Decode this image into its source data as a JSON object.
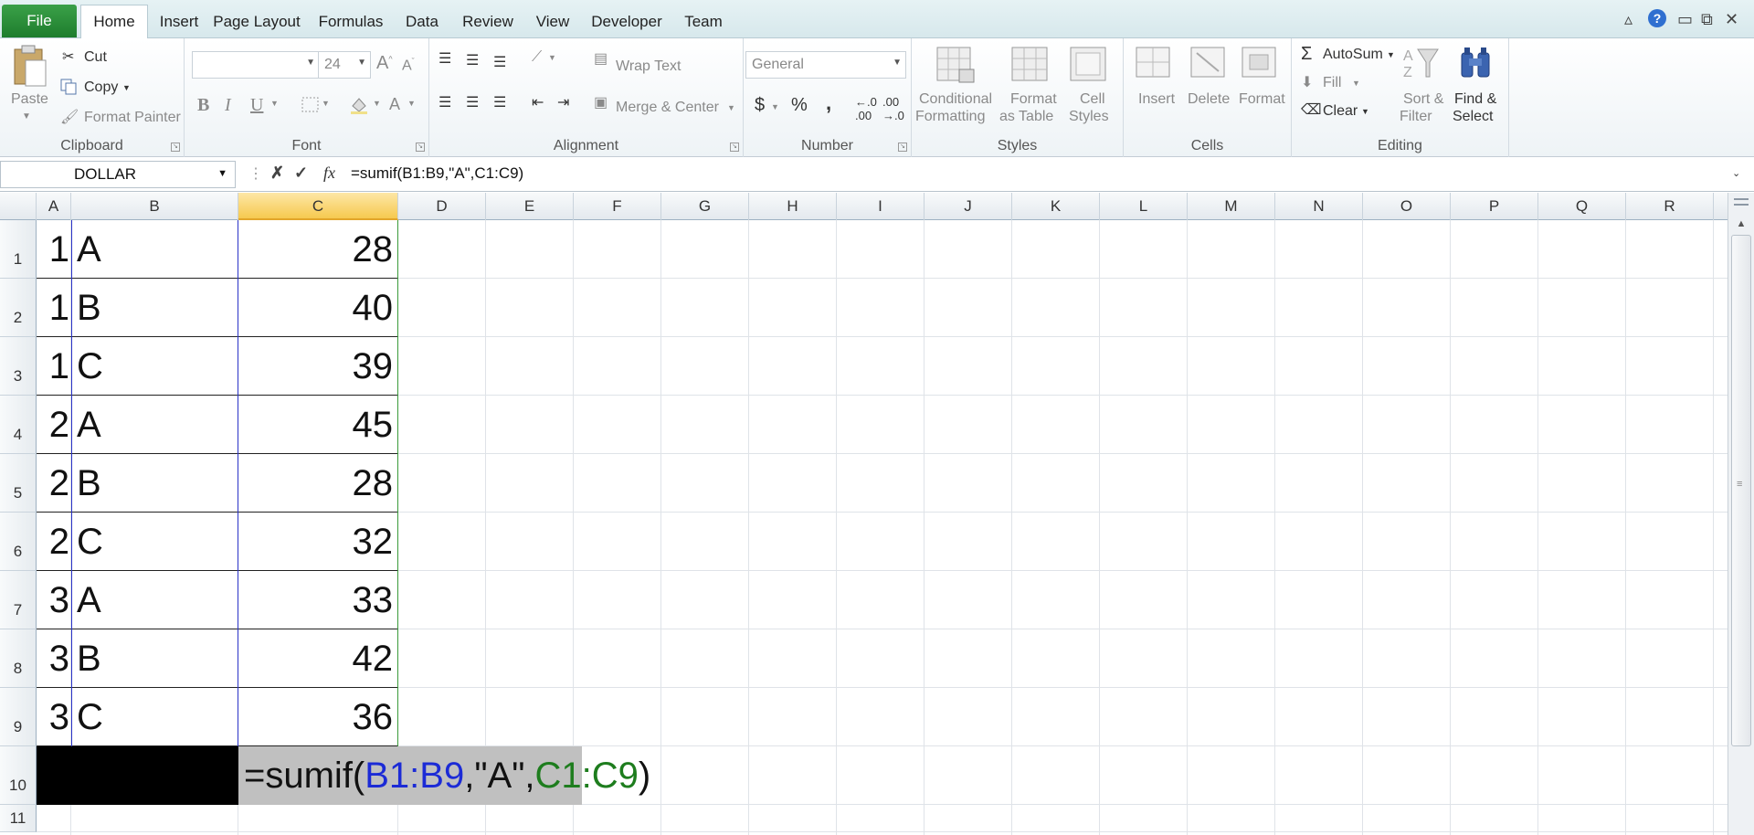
{
  "menu": {
    "file": "File",
    "tabs": [
      "Home",
      "Insert",
      "Page Layout",
      "Formulas",
      "Data",
      "Review",
      "View",
      "Developer",
      "Team"
    ]
  },
  "ribbon": {
    "clipboard": {
      "label": "Clipboard",
      "paste": "Paste",
      "cut": "Cut",
      "copy": "Copy",
      "format_painter": "Format Painter"
    },
    "font": {
      "label": "Font",
      "size": "24",
      "bold": "B",
      "italic": "I",
      "underline": "U"
    },
    "alignment": {
      "label": "Alignment",
      "wrap_text": "Wrap Text",
      "merge_center": "Merge & Center"
    },
    "number": {
      "label": "Number",
      "format": "General",
      "currency": "$",
      "percent": "%",
      "comma": ","
    },
    "styles": {
      "label": "Styles",
      "conditional_1": "Conditional",
      "conditional_2": "Formatting",
      "format_table_1": "Format",
      "format_table_2": "as Table",
      "cell_styles_1": "Cell",
      "cell_styles_2": "Styles"
    },
    "cells": {
      "label": "Cells",
      "insert": "Insert",
      "delete": "Delete",
      "format": "Format"
    },
    "editing": {
      "label": "Editing",
      "autosum": "AutoSum",
      "fill": "Fill",
      "clear": "Clear",
      "sort_1": "Sort &",
      "sort_2": "Filter",
      "find_1": "Find &",
      "find_2": "Select"
    }
  },
  "formula_bar": {
    "name_box": "DOLLAR",
    "fx": "fx",
    "formula": "=sumif(B1:B9,\"A\",C1:C9)"
  },
  "columns": [
    "A",
    "B",
    "C",
    "D",
    "E",
    "F",
    "G",
    "H",
    "I",
    "J",
    "K",
    "L",
    "M",
    "N",
    "O",
    "P",
    "Q",
    "R"
  ],
  "rows": [
    "1",
    "2",
    "3",
    "4",
    "5",
    "6",
    "7",
    "8",
    "9",
    "10",
    "11"
  ],
  "sheet": {
    "data": [
      [
        "1",
        "A",
        "28"
      ],
      [
        "1",
        "B",
        "40"
      ],
      [
        "1",
        "C",
        "39"
      ],
      [
        "2",
        "A",
        "45"
      ],
      [
        "2",
        "B",
        "28"
      ],
      [
        "2",
        "C",
        "32"
      ],
      [
        "3",
        "A",
        "33"
      ],
      [
        "3",
        "B",
        "42"
      ],
      [
        "3",
        "C",
        "36"
      ]
    ],
    "editing_cell": {
      "prefix": "=sumif(",
      "range1": "B1:B9",
      "middle": ",\"A\",",
      "range2": "C1:C9",
      "suffix": ")"
    }
  },
  "colors": {
    "file_tab": "#1e7d2d",
    "selected_column": "#f6c94f",
    "range1": "#1c2bd6",
    "range2": "#1e7d1e"
  }
}
